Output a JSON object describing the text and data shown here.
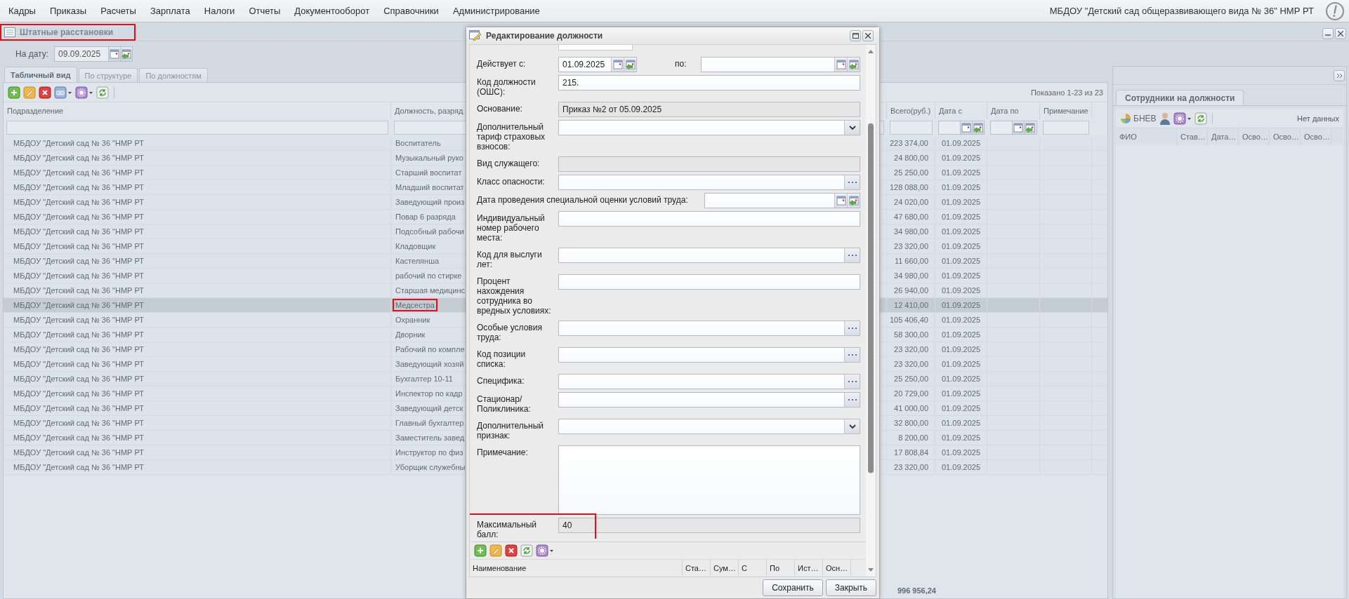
{
  "menu": [
    "Кадры",
    "Приказы",
    "Расчеты",
    "Зарплата",
    "Налоги",
    "Отчеты",
    "Документооборот",
    "Справочники",
    "Администрирование"
  ],
  "organization": "МБДОУ \"Детский сад общеразвивающего вида № 36\" НМР РТ",
  "panel": {
    "title": "Штатные расстановки",
    "highlighted": true,
    "date_label": "На дату:",
    "date_value": "09.09.2025",
    "tabs": [
      {
        "label": "Табличный вид",
        "selected": true
      },
      {
        "label": "По структуре",
        "selected": false
      },
      {
        "label": "По должностям",
        "selected": false
      }
    ],
    "records_info": "Показано 1-23 из 23",
    "table": {
      "columns": [
        "Подразделение",
        "Должность, разряд",
        "Всего(руб.)",
        "Дата с",
        "Дата по",
        "Примечание"
      ],
      "rows": [
        {
          "subdivision": "МБДОУ \"Детский сад № 36 \"НМР РТ",
          "position": "Воспитатель",
          "total": "223 374,00",
          "date_from": "01.09.2025",
          "selected": false,
          "highlighted": false
        },
        {
          "subdivision": "МБДОУ \"Детский сад № 36 \"НМР РТ",
          "position": "Музыкальный руко",
          "total": "24 800,00",
          "date_from": "01.09.2025",
          "selected": false,
          "highlighted": false
        },
        {
          "subdivision": "МБДОУ \"Детский сад № 36 \"НМР РТ",
          "position": "Старший воспитат",
          "total": "25 250,00",
          "date_from": "01.09.2025",
          "selected": false,
          "highlighted": false
        },
        {
          "subdivision": "МБДОУ \"Детский сад № 36 \"НМР РТ",
          "position": "Младший воспитат",
          "total": "128 088,00",
          "date_from": "01.09.2025",
          "selected": false,
          "highlighted": false
        },
        {
          "subdivision": "МБДОУ \"Детский сад № 36 \"НМР РТ",
          "position": "Заведующий произ",
          "total": "24 020,00",
          "date_from": "01.09.2025",
          "selected": false,
          "highlighted": false
        },
        {
          "subdivision": "МБДОУ \"Детский сад № 36 \"НМР РТ",
          "position": "Повар 6 разряда",
          "total": "47 680,00",
          "date_from": "01.09.2025",
          "selected": false,
          "highlighted": false
        },
        {
          "subdivision": "МБДОУ \"Детский сад № 36 \"НМР РТ",
          "position": "Подсобный рабочи",
          "total": "34 980,00",
          "date_from": "01.09.2025",
          "selected": false,
          "highlighted": false
        },
        {
          "subdivision": "МБДОУ \"Детский сад № 36 \"НМР РТ",
          "position": "Кладовщик",
          "total": "23 320,00",
          "date_from": "01.09.2025",
          "selected": false,
          "highlighted": false
        },
        {
          "subdivision": "МБДОУ \"Детский сад № 36 \"НМР РТ",
          "position": "Кастелянша",
          "total": "11 660,00",
          "date_from": "01.09.2025",
          "selected": false,
          "highlighted": false
        },
        {
          "subdivision": "МБДОУ \"Детский сад № 36 \"НМР РТ",
          "position": "рабочий по стирке",
          "total": "34 980,00",
          "date_from": "01.09.2025",
          "selected": false,
          "highlighted": false
        },
        {
          "subdivision": "МБДОУ \"Детский сад № 36 \"НМР РТ",
          "position": "Старшая медицинс",
          "total": "26 940,00",
          "date_from": "01.09.2025",
          "selected": false,
          "highlighted": false
        },
        {
          "subdivision": "МБДОУ \"Детский сад № 36 \"НМР РТ",
          "position": "Медсестра",
          "total": "12 410,00",
          "date_from": "01.09.2025",
          "selected": true,
          "highlighted": true
        },
        {
          "subdivision": "МБДОУ \"Детский сад № 36 \"НМР РТ",
          "position": "Охранник",
          "total": "105 406,40",
          "date_from": "01.09.2025",
          "selected": false,
          "highlighted": false
        },
        {
          "subdivision": "МБДОУ \"Детский сад № 36 \"НМР РТ",
          "position": "Дворник",
          "total": "58 300,00",
          "date_from": "01.09.2025",
          "selected": false,
          "highlighted": false
        },
        {
          "subdivision": "МБДОУ \"Детский сад № 36 \"НМР РТ",
          "position": "Рабочий по компле",
          "total": "23 320,00",
          "date_from": "01.09.2025",
          "selected": false,
          "highlighted": false
        },
        {
          "subdivision": "МБДОУ \"Детский сад № 36 \"НМР РТ",
          "position": "Заведующий хозяй",
          "total": "23 320,00",
          "date_from": "01.09.2025",
          "selected": false,
          "highlighted": false
        },
        {
          "subdivision": "МБДОУ \"Детский сад № 36 \"НМР РТ",
          "position": "Бухгалтер 10-11",
          "total": "25 250,00",
          "date_from": "01.09.2025",
          "selected": false,
          "highlighted": false
        },
        {
          "subdivision": "МБДОУ \"Детский сад № 36 \"НМР РТ",
          "position": "Инспектор по кадр",
          "total": "20 729,00",
          "date_from": "01.09.2025",
          "selected": false,
          "highlighted": false
        },
        {
          "subdivision": "МБДОУ \"Детский сад № 36 \"НМР РТ",
          "position": "Заведующий детск",
          "total": "41 000,00",
          "date_from": "01.09.2025",
          "selected": false,
          "highlighted": false
        },
        {
          "subdivision": "МБДОУ \"Детский сад № 36 \"НМР РТ",
          "position": "Главный бухгалтер",
          "total": "32 800,00",
          "date_from": "01.09.2025",
          "selected": false,
          "highlighted": false
        },
        {
          "subdivision": "МБДОУ \"Детский сад № 36 \"НМР РТ",
          "position": "Заместитель завед",
          "total": "8 200,00",
          "date_from": "01.09.2025",
          "selected": false,
          "highlighted": false
        },
        {
          "subdivision": "МБДОУ \"Детский сад № 36 \"НМР РТ",
          "position": "Инструктор по физ",
          "total": "17 808,84",
          "date_from": "01.09.2025",
          "selected": false,
          "highlighted": false
        },
        {
          "subdivision": "МБДОУ \"Детский сад № 36 \"НМР РТ",
          "position": "Уборщик служебны",
          "total": "23 320,00",
          "date_from": "01.09.2025",
          "selected": false,
          "highlighted": false
        }
      ],
      "footer_total": "996 956,24"
    }
  },
  "side_panel": {
    "tabs": [
      {
        "label": "Сотрудники на должности",
        "selected": true
      }
    ],
    "user_label": "БНЕВ",
    "status": "Нет данных",
    "columns": [
      "ФИО",
      "Став…",
      "Дата…",
      "Осво…",
      "Осво…",
      "Осво…"
    ]
  },
  "dialog": {
    "title": "Редактирование должности",
    "fields": [
      {
        "kind": "date-range",
        "label": "Действует с:",
        "value": "01.09.2025",
        "to_label": "по:"
      },
      {
        "kind": "text",
        "label": "Код должности (ОШС):",
        "value": "215."
      },
      {
        "kind": "readonly",
        "label": "Основание:",
        "value": "Приказ №2 от 05.09.2025"
      },
      {
        "kind": "combo",
        "label": "Дополнительный тариф страховых взносов:"
      },
      {
        "kind": "readonly",
        "label": "Вид служащего:"
      },
      {
        "kind": "lookup",
        "label": "Класс опасности:"
      },
      {
        "kind": "date",
        "label": "Дата проведения специальной оценки условий труда:"
      },
      {
        "kind": "text",
        "label": "Индивидуальный номер рабочего места:"
      },
      {
        "kind": "lookup",
        "label": "Код для выслуги лет:"
      },
      {
        "kind": "text",
        "label": "Процент нахождения сотрудника во вредных условиях:"
      },
      {
        "kind": "lookup",
        "label": "Особые условия труда:"
      },
      {
        "kind": "lookup",
        "label": "Код позиции списка:"
      },
      {
        "kind": "lookup",
        "label": "Специфика:"
      },
      {
        "kind": "lookup",
        "label": "Стационар/Поликлиника:"
      },
      {
        "kind": "combo",
        "label": "Дополнительный признак:"
      },
      {
        "kind": "textarea",
        "label": "Примечание:"
      },
      {
        "kind": "readonly",
        "label": "Максимальный балл:",
        "value": "40",
        "highlighted": true
      }
    ],
    "grid_columns": [
      "Наименование",
      "Ста…",
      "Сум…",
      "С",
      "По",
      "Ист…",
      "Осн…"
    ],
    "buttons": [
      "Сохранить",
      "Закрыть"
    ]
  }
}
